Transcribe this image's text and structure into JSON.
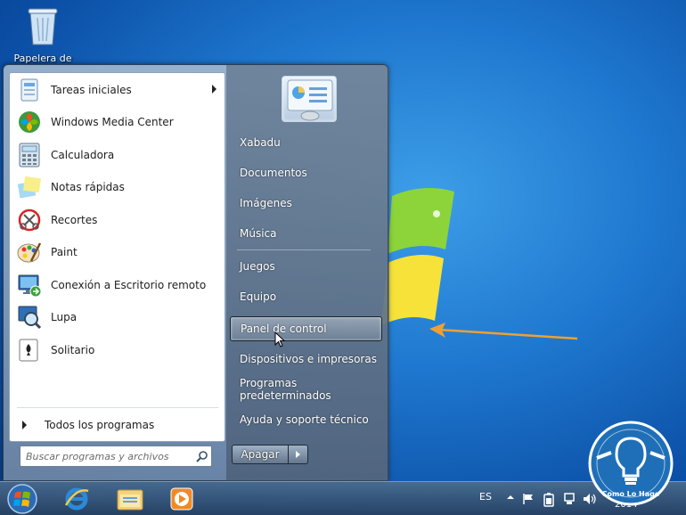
{
  "desktop": {
    "recycle_bin_label": "Papelera de"
  },
  "start_menu": {
    "programs": [
      {
        "label": "Tareas iniciales",
        "icon": "getting-started-icon",
        "has_submenu": true
      },
      {
        "label": "Windows Media Center",
        "icon": "media-center-icon"
      },
      {
        "label": "Calculadora",
        "icon": "calculator-icon"
      },
      {
        "label": "Notas rápidas",
        "icon": "sticky-notes-icon"
      },
      {
        "label": "Recortes",
        "icon": "snipping-tool-icon"
      },
      {
        "label": "Paint",
        "icon": "paint-icon"
      },
      {
        "label": "Conexión a Escritorio remoto",
        "icon": "remote-desktop-icon"
      },
      {
        "label": "Lupa",
        "icon": "magnifier-icon"
      },
      {
        "label": "Solitario",
        "icon": "solitaire-icon"
      }
    ],
    "all_programs_label": "Todos los programas",
    "search_placeholder": "Buscar programas y archivos",
    "right_items": [
      {
        "label": "Xabadu"
      },
      {
        "label": "Documentos"
      },
      {
        "label": "Imágenes"
      },
      {
        "label": "Música"
      },
      {
        "label": "Juegos"
      },
      {
        "label": "Equipo"
      },
      {
        "label": "Panel de control",
        "highlighted": true
      },
      {
        "label": "Dispositivos e impresoras"
      },
      {
        "label": "Programas predeterminados"
      },
      {
        "label": "Ayuda y soporte técnico"
      }
    ],
    "shutdown_label": "Apagar"
  },
  "taskbar": {
    "apps": [
      "internet-explorer-icon",
      "file-explorer-icon",
      "media-player-icon"
    ],
    "tray": {
      "language": "ES",
      "date": "2014"
    }
  },
  "watermark": {
    "text": "Como Lo Hago"
  },
  "colors": {
    "annotation_arrow": "#f0a030",
    "desktop_blue": "#1f78cf"
  }
}
